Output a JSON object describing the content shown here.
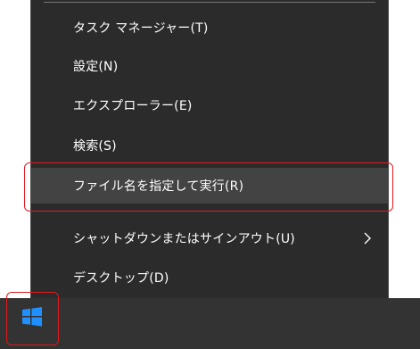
{
  "context_menu": {
    "items": [
      {
        "label": "タスク マネージャー(T)"
      },
      {
        "label": "設定(N)"
      },
      {
        "label": "エクスプローラー(E)"
      },
      {
        "label": "検索(S)"
      },
      {
        "label": "ファイル名を指定して実行(R)",
        "highlighted": true
      },
      {
        "label": "シャットダウンまたはサインアウト(U)",
        "has_submenu": true
      },
      {
        "label": "デスクトップ(D)"
      }
    ]
  },
  "taskbar": {
    "start_icon": "windows-logo-icon"
  },
  "colors": {
    "menu_background": "#2b2b2b",
    "menu_highlight": "#434343",
    "menu_text": "#ffffff",
    "callout_red": "#e0191e",
    "windows_blue": "#1e90ff",
    "taskbar": "#333333"
  }
}
